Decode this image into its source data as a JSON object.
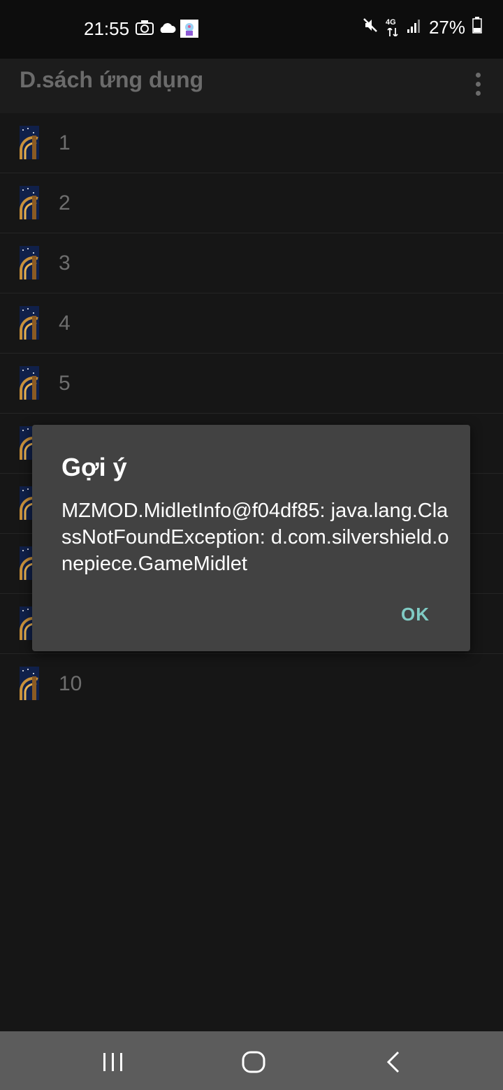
{
  "status_bar": {
    "time": "21:55",
    "battery_percent": "27%",
    "network": "4G",
    "icons": [
      "camera-icon",
      "cloud-icon",
      "app-notification-icon",
      "mute-icon",
      "network-4g-icon",
      "signal-icon",
      "battery-icon"
    ]
  },
  "app_bar": {
    "title": "D.sách ứng dụng",
    "menu_icon": "overflow-menu-icon"
  },
  "list": {
    "items": [
      {
        "label": "1"
      },
      {
        "label": "2"
      },
      {
        "label": "3"
      },
      {
        "label": "4"
      },
      {
        "label": "5"
      },
      {
        "label": ""
      },
      {
        "label": ""
      },
      {
        "label": ""
      },
      {
        "label": ""
      },
      {
        "label": "10"
      }
    ]
  },
  "dialog": {
    "title": "Gợi ý",
    "message": "MZMOD.MidletInfo@f04df85: java.lang.ClassNotFoundException: d.com.silvershield.onepiece.GameMidlet",
    "ok_label": "OK"
  },
  "nav_bar": {
    "icons": [
      "recent-apps-icon",
      "home-icon",
      "back-icon"
    ]
  },
  "colors": {
    "background": "#161616",
    "dialog": "#424242",
    "accent": "#80cbc4",
    "navbar": "#5c5c5c"
  }
}
